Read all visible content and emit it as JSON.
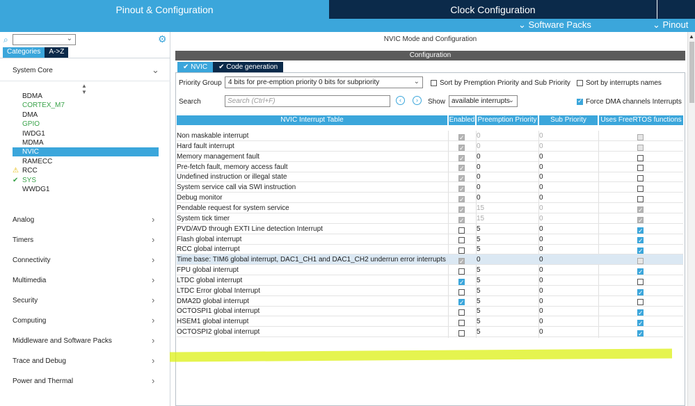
{
  "top_tabs": {
    "pinout": "Pinout & Configuration",
    "clock": "Clock Configuration"
  },
  "subbar": {
    "software_packs": "⌄ Software Packs",
    "pinout": "⌄ Pinout"
  },
  "sidebar": {
    "tabs": [
      "Categories",
      "A->Z"
    ],
    "system_core": "System Core",
    "peripherals": [
      {
        "label": "BDMA",
        "state": "normal"
      },
      {
        "label": "CORTEX_M7",
        "state": "green"
      },
      {
        "label": "DMA",
        "state": "normal"
      },
      {
        "label": "GPIO",
        "state": "green"
      },
      {
        "label": "IWDG1",
        "state": "normal"
      },
      {
        "label": "MDMA",
        "state": "normal"
      },
      {
        "label": "NVIC",
        "state": "selected"
      },
      {
        "label": "RAMECC",
        "state": "normal"
      },
      {
        "label": "RCC",
        "state": "warning"
      },
      {
        "label": "SYS",
        "state": "check"
      },
      {
        "label": "WWDG1",
        "state": "normal"
      }
    ],
    "categories": [
      "Analog",
      "Timers",
      "Connectivity",
      "Multimedia",
      "Security",
      "Computing",
      "Middleware and Software Packs",
      "Trace and Debug",
      "Power and Thermal"
    ]
  },
  "main": {
    "title": "NVIC Mode and Configuration",
    "config": "Configuration",
    "tab_nvic": "NVIC",
    "tab_codegen": "Code generation",
    "priority_group_label": "Priority Group",
    "priority_group_value": "4 bits for pre-emption priority 0 bits for subpriority",
    "sort_preempt": "Sort by Premption Priority and Sub Priority",
    "sort_names": "Sort by interrupts names",
    "search_label": "Search",
    "search_placeholder": "Search (Ctrl+F)",
    "show_label": "Show",
    "show_value": "available interrupts",
    "force_dma": "Force DMA channels Interrupts",
    "table_headers": [
      "NVIC Interrupt Table",
      "Enabled",
      "Preemption Priority",
      "Sub Priority",
      "Uses FreeRTOS functions"
    ]
  },
  "interrupts": [
    {
      "name": "Non maskable interrupt",
      "enabled": true,
      "en_disabled": true,
      "pp": "0",
      "sp": "0",
      "pp_dim": true,
      "rtos": false,
      "rtos_disabled": true
    },
    {
      "name": "Hard fault interrupt",
      "enabled": true,
      "en_disabled": true,
      "pp": "0",
      "sp": "0",
      "pp_dim": true,
      "rtos": false,
      "rtos_disabled": true
    },
    {
      "name": "Memory management fault",
      "enabled": true,
      "en_disabled": true,
      "pp": "0",
      "sp": "0",
      "pp_dim": false,
      "rtos": false,
      "rtos_disabled": false
    },
    {
      "name": "Pre-fetch fault, memory access fault",
      "enabled": true,
      "en_disabled": true,
      "pp": "0",
      "sp": "0",
      "pp_dim": false,
      "rtos": false,
      "rtos_disabled": false
    },
    {
      "name": "Undefined instruction or illegal state",
      "enabled": true,
      "en_disabled": true,
      "pp": "0",
      "sp": "0",
      "pp_dim": false,
      "rtos": false,
      "rtos_disabled": false
    },
    {
      "name": "System service call via SWI instruction",
      "enabled": true,
      "en_disabled": true,
      "pp": "0",
      "sp": "0",
      "pp_dim": false,
      "rtos": false,
      "rtos_disabled": false
    },
    {
      "name": "Debug monitor",
      "enabled": true,
      "en_disabled": true,
      "pp": "0",
      "sp": "0",
      "pp_dim": false,
      "rtos": false,
      "rtos_disabled": false
    },
    {
      "name": "Pendable request for system service",
      "enabled": true,
      "en_disabled": true,
      "pp": "15",
      "sp": "0",
      "pp_dim": true,
      "rtos": true,
      "rtos_disabled": true
    },
    {
      "name": "System tick timer",
      "enabled": true,
      "en_disabled": true,
      "pp": "15",
      "sp": "0",
      "pp_dim": true,
      "rtos": true,
      "rtos_disabled": true
    },
    {
      "name": "PVD/AVD through EXTI Line detection Interrupt",
      "enabled": false,
      "en_disabled": false,
      "pp": "5",
      "sp": "0",
      "pp_dim": false,
      "rtos": true,
      "rtos_disabled": false
    },
    {
      "name": "Flash global interrupt",
      "enabled": false,
      "en_disabled": false,
      "pp": "5",
      "sp": "0",
      "pp_dim": false,
      "rtos": true,
      "rtos_disabled": false
    },
    {
      "name": "RCC global interrupt",
      "enabled": false,
      "en_disabled": false,
      "pp": "5",
      "sp": "0",
      "pp_dim": false,
      "rtos": true,
      "rtos_disabled": false
    },
    {
      "name": "Time base: TIM6 global interrupt, DAC1_CH1 and DAC1_CH2 underrun error interrupts",
      "enabled": true,
      "en_disabled": true,
      "pp": "0",
      "sp": "0",
      "pp_dim": false,
      "rtos": false,
      "rtos_disabled": true,
      "highlight": true
    },
    {
      "name": "FPU global interrupt",
      "enabled": false,
      "en_disabled": false,
      "pp": "5",
      "sp": "0",
      "pp_dim": false,
      "rtos": true,
      "rtos_disabled": false
    },
    {
      "name": "LTDC global interrupt",
      "enabled": true,
      "en_disabled": false,
      "pp": "5",
      "sp": "0",
      "pp_dim": false,
      "rtos": false,
      "rtos_disabled": false
    },
    {
      "name": "LTDC Error global Interrupt",
      "enabled": false,
      "en_disabled": false,
      "pp": "5",
      "sp": "0",
      "pp_dim": false,
      "rtos": true,
      "rtos_disabled": false
    },
    {
      "name": "DMA2D global interrupt",
      "enabled": true,
      "en_disabled": false,
      "pp": "5",
      "sp": "0",
      "pp_dim": false,
      "rtos": false,
      "rtos_disabled": false
    },
    {
      "name": "OCTOSPI1 global interrupt",
      "enabled": false,
      "en_disabled": false,
      "pp": "5",
      "sp": "0",
      "pp_dim": false,
      "rtos": true,
      "rtos_disabled": false
    },
    {
      "name": "HSEM1 global interrupt",
      "enabled": false,
      "en_disabled": false,
      "pp": "5",
      "sp": "0",
      "pp_dim": false,
      "rtos": true,
      "rtos_disabled": false
    },
    {
      "name": "OCTOSPI2 global interrupt",
      "enabled": false,
      "en_disabled": false,
      "pp": "5",
      "sp": "0",
      "pp_dim": false,
      "rtos": true,
      "rtos_disabled": false
    }
  ],
  "colors": {
    "accent": "#3ba6db",
    "dark": "#0b2a4a",
    "highlighter": "#dcf014"
  }
}
